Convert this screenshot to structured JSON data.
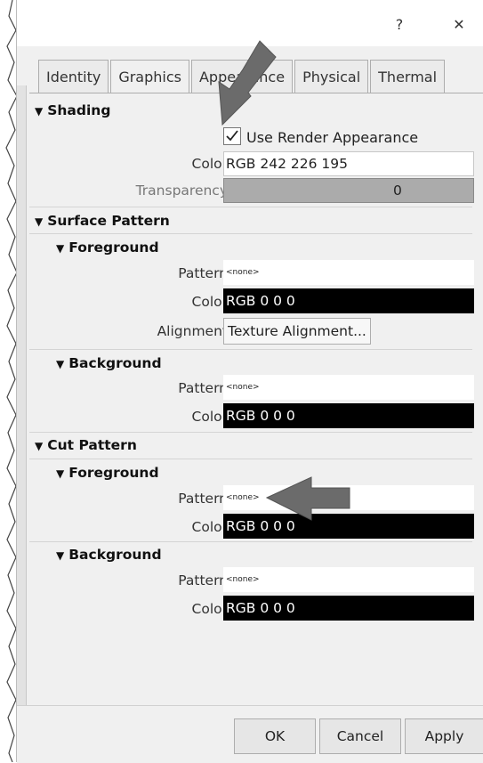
{
  "titlebar": {
    "help_label": "?",
    "close_label": "✕"
  },
  "tabs": [
    {
      "label": "Identity",
      "active": false
    },
    {
      "label": "Graphics",
      "active": true
    },
    {
      "label": "Appearance",
      "active": false
    },
    {
      "label": "Physical",
      "active": false
    },
    {
      "label": "Thermal",
      "active": false
    }
  ],
  "shading": {
    "heading": "Shading",
    "use_render_label": "Use Render Appearance",
    "use_render_checked": true,
    "color_label": "Color",
    "color_value": "RGB 242 226 195",
    "transparency_label": "Transparency",
    "transparency_value": "0"
  },
  "surface_pattern": {
    "heading": "Surface Pattern",
    "foreground": {
      "heading": "Foreground",
      "pattern_label": "Pattern",
      "pattern_value": "<none>",
      "color_label": "Color",
      "color_value": "RGB 0 0 0",
      "alignment_label": "Alignment",
      "alignment_button": "Texture Alignment..."
    },
    "background": {
      "heading": "Background",
      "pattern_label": "Pattern",
      "pattern_value": "<none>",
      "color_label": "Color",
      "color_value": "RGB 0 0 0"
    }
  },
  "cut_pattern": {
    "heading": "Cut Pattern",
    "foreground": {
      "heading": "Foreground",
      "pattern_label": "Pattern",
      "pattern_value": "<none>",
      "color_label": "Color",
      "color_value": "RGB 0 0 0"
    },
    "background": {
      "heading": "Background",
      "pattern_label": "Pattern",
      "pattern_value": "<none>",
      "color_label": "Color",
      "color_value": "RGB 0 0 0"
    }
  },
  "footer": {
    "ok_label": "OK",
    "cancel_label": "Cancel",
    "apply_label": "Apply"
  },
  "colors": {
    "annotation_arrow": "#6b6b6b",
    "pattern_swatch": "#000000"
  }
}
